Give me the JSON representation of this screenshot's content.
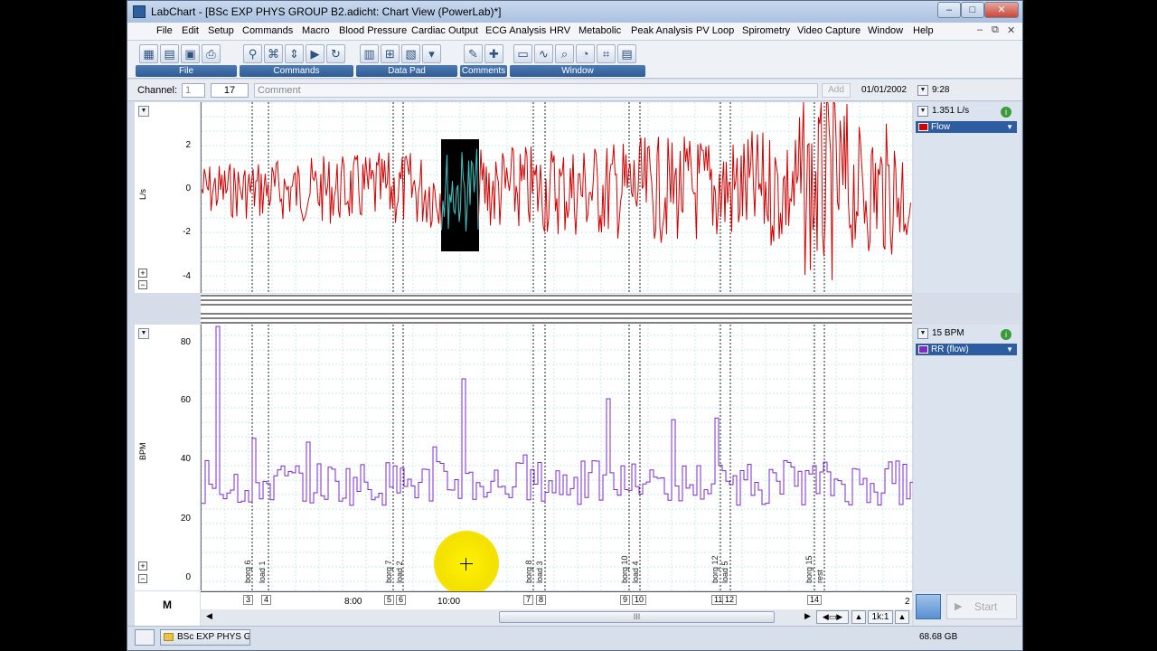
{
  "window": {
    "title": "LabChart - [BSc EXP PHYS GROUP B2.adicht: Chart View (PowerLab)*]"
  },
  "menu": [
    "File",
    "Edit",
    "Setup",
    "Commands",
    "Macro",
    "Blood Pressure",
    "Cardiac Output",
    "ECG Analysis",
    "HRV",
    "Metabolic",
    "Peak Analysis",
    "PV Loop",
    "Spirometry",
    "Video Capture",
    "Window",
    "Help"
  ],
  "toolbar_groups": [
    "File",
    "Commands",
    "Data Pad",
    "Comments",
    "Window"
  ],
  "channel_bar": {
    "label": "Channel:",
    "channel_value": "1",
    "comment_number": "17",
    "comment_placeholder": "Comment",
    "add_label": "Add",
    "date": "01/01/2002",
    "time": "9:28"
  },
  "channels": [
    {
      "name": "Flow",
      "unit": "L/s",
      "value_display": "1.351 L/s",
      "color": "#d40000",
      "selection_color": "#28c8c8",
      "y_ticks": [
        "2",
        "0",
        "-2",
        "-4"
      ]
    },
    {
      "name": "RR (flow)",
      "unit": "BPM",
      "value_display": "15 BPM",
      "color": "#7a2bc8",
      "y_ticks": [
        "80",
        "60",
        "40",
        "20",
        "0"
      ]
    }
  ],
  "time_axis": {
    "labels": [
      "8:00",
      "10:00",
      "2"
    ],
    "comment_markers": [
      "3",
      "4",
      "5",
      "6",
      "7",
      "8",
      "9",
      "10",
      "11",
      "12",
      "14"
    ]
  },
  "annotations": [
    "borg 6",
    "load 1",
    "borg 7",
    "load 2",
    "borg 8",
    "load 3",
    "borg 10",
    "load 4",
    "borg 12",
    "load 5",
    "borg 15",
    "rest"
  ],
  "bottom": {
    "zoom": "1k:1",
    "start_label": "Start",
    "scroll_grip": "III"
  },
  "status": {
    "task_label": "BSc EXP PHYS G...",
    "disk_free": "68.68 GB"
  },
  "icons": [
    "labchart-app-icon",
    "minimize-icon",
    "maximize-icon",
    "close-icon",
    "new-file-icon",
    "open-icon",
    "save-icon",
    "print-icon",
    "binoculars-icon",
    "multi-icon",
    "macro-icon",
    "data-pad-icon",
    "comment-icon",
    "window-icon",
    "info-icon",
    "dropdown-icon",
    "plus-icon",
    "minus-icon",
    "start-icon"
  ]
}
